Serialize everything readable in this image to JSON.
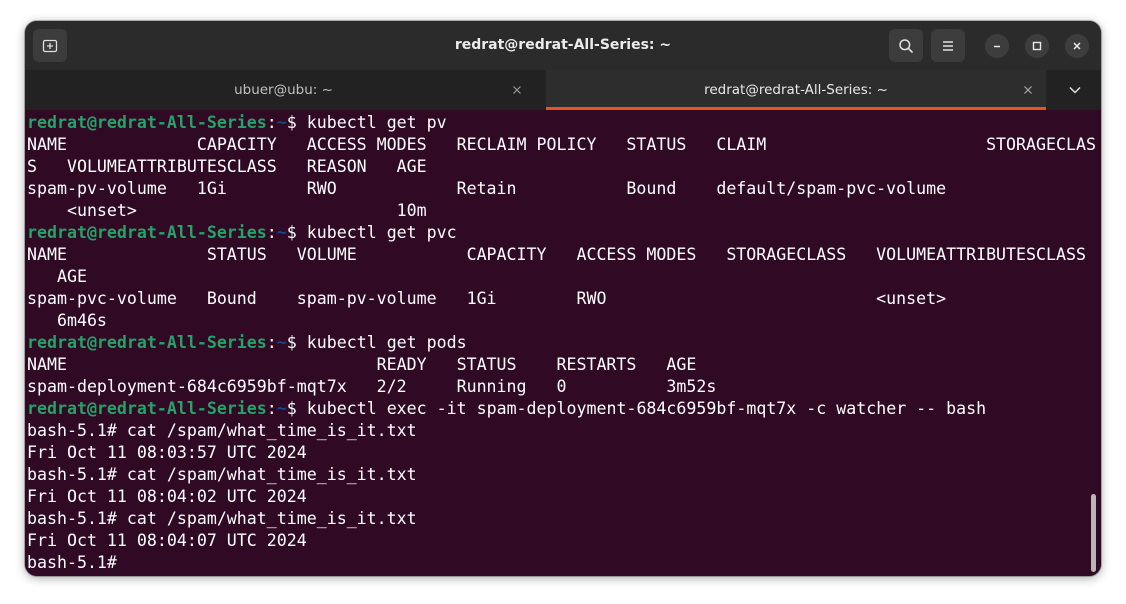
{
  "window": {
    "title": "redrat@redrat-All-Series: ~"
  },
  "tabs": [
    {
      "label": "ubuer@ubu: ~",
      "active": false
    },
    {
      "label": "redrat@redrat-All-Series: ~",
      "active": true
    }
  ],
  "icons": {
    "new_tab": "new-tab-icon",
    "search": "search-icon",
    "menu": "hamburger-menu-icon",
    "minimize": "minimize-icon",
    "maximize": "maximize-icon",
    "close": "close-icon",
    "tab_close": "close-icon",
    "tabs_dropdown": "chevron-down-icon"
  },
  "colors": {
    "terminal_background": "#300a24",
    "prompt_user_host": "#26a269",
    "prompt_path": "#12488b",
    "text": "#ffffff",
    "active_tab_indicator": "#e95420",
    "titlebar": "#2b2b2b"
  },
  "terminal": {
    "prompt": {
      "user_host": "redrat@redrat-All-Series",
      "sep": ":",
      "path": "~",
      "symbol": "$ "
    },
    "lines": [
      {
        "type": "prompt",
        "cmd": "kubectl get pv"
      },
      {
        "type": "out",
        "text": "NAME             CAPACITY   ACCESS MODES   RECLAIM POLICY   STATUS   CLAIM                      STORAGECLAS"
      },
      {
        "type": "out",
        "text": "S   VOLUMEATTRIBUTESCLASS   REASON   AGE"
      },
      {
        "type": "out",
        "text": "spam-pv-volume   1Gi        RWO            Retain           Bound    default/spam-pvc-volume"
      },
      {
        "type": "out",
        "text": "    <unset>                          10m"
      },
      {
        "type": "prompt",
        "cmd": "kubectl get pvc"
      },
      {
        "type": "out",
        "text": "NAME              STATUS   VOLUME           CAPACITY   ACCESS MODES   STORAGECLASS   VOLUMEATTRIBUTESCLASS"
      },
      {
        "type": "out",
        "text": "   AGE"
      },
      {
        "type": "out",
        "text": "spam-pvc-volume   Bound    spam-pv-volume   1Gi        RWO                           <unset>"
      },
      {
        "type": "out",
        "text": "   6m46s"
      },
      {
        "type": "prompt",
        "cmd": "kubectl get pods"
      },
      {
        "type": "out",
        "text": "NAME                               READY   STATUS    RESTARTS   AGE"
      },
      {
        "type": "out",
        "text": "spam-deployment-684c6959bf-mqt7x   2/2     Running   0          3m52s"
      },
      {
        "type": "prompt",
        "cmd": "kubectl exec -it spam-deployment-684c6959bf-mqt7x -c watcher -- bash"
      },
      {
        "type": "out",
        "text": "bash-5.1# cat /spam/what_time_is_it.txt"
      },
      {
        "type": "out",
        "text": "Fri Oct 11 08:03:57 UTC 2024"
      },
      {
        "type": "out",
        "text": "bash-5.1# cat /spam/what_time_is_it.txt"
      },
      {
        "type": "out",
        "text": "Fri Oct 11 08:04:02 UTC 2024"
      },
      {
        "type": "out",
        "text": "bash-5.1# cat /spam/what_time_is_it.txt"
      },
      {
        "type": "out",
        "text": "Fri Oct 11 08:04:07 UTC 2024"
      },
      {
        "type": "out",
        "text": "bash-5.1# "
      }
    ]
  }
}
